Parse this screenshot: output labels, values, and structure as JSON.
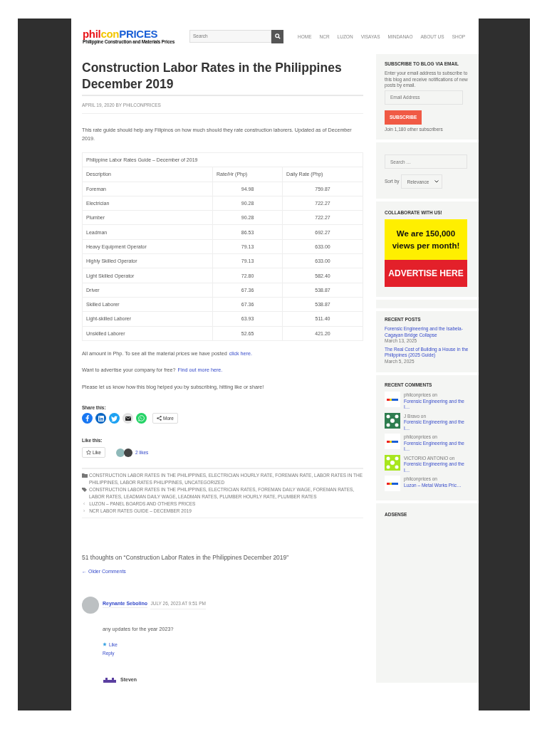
{
  "logo": {
    "part_1": "phil",
    "part_2": "con",
    "part_3": "PRICES",
    "tagline": "Philippine Construction and Materials Prices"
  },
  "search": {
    "placeholder": "Search"
  },
  "nav": [
    "HOME",
    "NCR",
    "LUZON",
    "VISAYAS",
    "MINDANAO",
    "ABOUT US",
    "SHOP"
  ],
  "article": {
    "title": "Construction Labor Rates in the Philippines December 2019",
    "meta": "APRIL 19, 2020 BY PHILCONPRICES",
    "intro": "This rate guide should help any Filipinos on how much should they rate construction laborers. Updated as of December 2019."
  },
  "table": {
    "caption": "Philippine Labor Rates Guide – December of 2019",
    "columns": [
      "Description",
      "Rate/Hr (Php)",
      "Daily Rate (Php)"
    ],
    "rows": [
      [
        "Foreman",
        "94.98",
        "759.87"
      ],
      [
        "Electrician",
        "90.28",
        "722.27"
      ],
      [
        "Plumber",
        "90.28",
        "722.27"
      ],
      [
        "Leadman",
        "86.53",
        "692.27"
      ],
      [
        "Heavy Equipment Operator",
        "79.13",
        "633.00"
      ],
      [
        "Highly Skilled Operator",
        "79.13",
        "633.00"
      ],
      [
        "Light Skilled Operator",
        "72.80",
        "582.40"
      ],
      [
        "Driver",
        "67.36",
        "538.87"
      ],
      [
        "Skilled Laborer",
        "67.36",
        "538.87"
      ],
      [
        "Light-skilled Laborer",
        "63.93",
        "511.40"
      ],
      [
        "Unskilled Laborer",
        "52.65",
        "421.20"
      ]
    ]
  },
  "paragraphs": [
    {
      "text": "All amount in Php. To see all the material prices we have posted",
      "link": "click here."
    },
    {
      "text": "Want to advertise your company for free?",
      "link": "Find out more here."
    },
    {
      "text": "Please let us know how this blog helped you by subscribing, hitting like or share!"
    }
  ],
  "share": {
    "label": "Share this:",
    "buttons": [
      {
        "kind": "facebook"
      },
      {
        "kind": "linkedin"
      },
      {
        "kind": "twitter"
      },
      {
        "kind": "email"
      },
      {
        "kind": "whatsapp"
      }
    ],
    "more": "More"
  },
  "like": {
    "label": "Like this:",
    "button": "Like",
    "count": "2 likes"
  },
  "footer": {
    "categories": "CONSTRUCTION LABOR RATES IN THE PHILIPPINES, ELECTRICIAN HOURLY RATE, FOREMAN RATE, LABOR RATES IN THE PHILIPPINES, LABOR RATES PHILIPPINES, UNCATEGORIZED",
    "tags": "CONSTRUCTION LABOR RATES IN THE PHILIPPINES, ELECTRICIAN RATES, FOREMAN DAILY WAGE, FOREMAN RATES, LABOR RATES, LEADMAN DAILY WAGE, LEADMAN RATES, PLUMBER HOURLY RATE, PLUMBER RATES",
    "previous_arrow": "‹",
    "previous": "LUZON – PANEL BOARDS AND OTHERS PRICES",
    "next_arrow": "›",
    "next": "NCR LABOR RATES GUIDE – DECEMBER 2019"
  },
  "comments": {
    "heading": "51 thoughts on “Construction Labor Rates in the Philippines December 2019”",
    "older": "← Older Comments",
    "items": [
      {
        "author": "Reynante Sebolino",
        "date": "JULY 26, 2023 AT 9:51 PM",
        "text": "any updates for the year 2023?",
        "like": "Like",
        "reply": "Reply"
      }
    ],
    "next_author": "Steven"
  },
  "sidebar": {
    "subscribe": {
      "heading": "SUBSCRIBE TO BLOG VIA EMAIL",
      "description": "Enter your email address to subscribe to this blog and receive notifications of new posts by email.",
      "placeholder": "Email Address",
      "button": "SUBSCRIBE",
      "count": "Join 1,180 other subscribers"
    },
    "search": {
      "placeholder": "Search …",
      "sort_label": "Sort by",
      "sort_value": "Relevance"
    },
    "collaborate": {
      "heading": "COLLABORATE WITH US!",
      "ad_line_1": "We are 150,000",
      "ad_line_2": "views per month!",
      "ad_cta": "ADVERTISE HERE"
    },
    "recent_posts": {
      "heading": "RECENT POSTS",
      "items": [
        {
          "title": "Forensic Engineering and the Isabela-Cagayan Bridge Collapse",
          "date": "March 13, 2025"
        },
        {
          "title": "The Real Cost of Building a House in the Philippines (2025 Guide)",
          "date": "March 5, 2025"
        }
      ]
    },
    "recent_comments": {
      "heading": "RECENT COMMENTS",
      "items": [
        {
          "kind": "logo",
          "author": "philconprices",
          "on": "on",
          "link": "Forensic Engineering and the I…"
        },
        {
          "kind": "pattern",
          "color": "#2e7d4f",
          "author": "J Bravo",
          "on": "on",
          "link": "Forensic Engineering and the I…"
        },
        {
          "kind": "logo",
          "author": "philconprices",
          "on": "on",
          "link": "Forensic Engineering and the I…"
        },
        {
          "kind": "pattern",
          "color": "#a8e61e",
          "author": "VICTORIO ANTONIO",
          "on": "on",
          "link": "Forensic Engineering and the I…"
        },
        {
          "kind": "logo",
          "author": "philconprices",
          "on": "on",
          "link": "Luzon – Metal Works Pric…"
        }
      ]
    },
    "adsense": {
      "heading": "ADSENSE"
    }
  }
}
